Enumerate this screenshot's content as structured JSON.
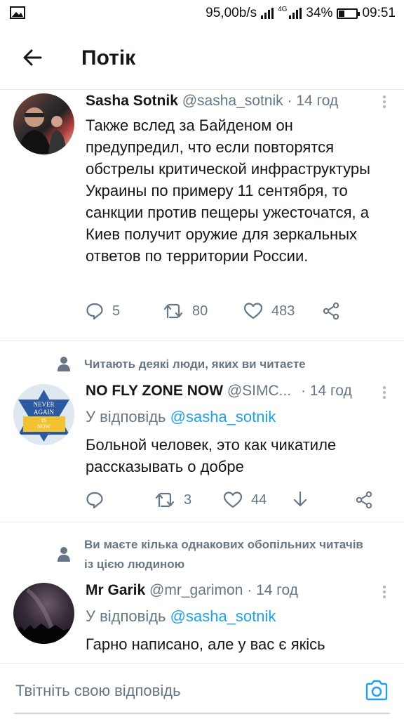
{
  "status_bar": {
    "speed": "95,00b/s",
    "network": "4G",
    "battery": "34%",
    "battery_level": 0.34,
    "time": "09:51"
  },
  "header": {
    "title": "Потік"
  },
  "tweets": [
    {
      "name": "Sasha Sotnik",
      "handle": "@sasha_sotnik",
      "time": "· 14 год",
      "text": "Также вслед за Байденом он предупредил, что если повторятся обстрелы критической инфраструктуры Украины по примеру 11 сентября, то санкции против пещеры ужесточатся, а Киев получит оружие для зеркальных ответов по территории России.",
      "replies": "5",
      "retweets": "80",
      "likes": "483"
    },
    {
      "social_context": "Читають деякі люди, яких ви читаєте",
      "name": "NO FLY ZONE NOW",
      "handle": "@SIMC...",
      "time": "· 14 год",
      "reply_prefix": "У відповідь",
      "reply_handle": "@sasha_sotnik",
      "text": "Больной человек, это как чикатиле рассказывать о добре",
      "avatar_text": "NEVER AGAIN IS NOW",
      "retweets": "3",
      "likes": "44"
    },
    {
      "social_context": "Ви маєте кілька однакових обопільних читачів із цією людиною",
      "name": "Mr Garik",
      "handle": "@mr_garimon",
      "time": "· 14 год",
      "reply_prefix": "У відповідь",
      "reply_handle": "@sasha_sotnik",
      "text": "Гарно написано, але у вас є якісь"
    }
  ],
  "compose": {
    "placeholder": "Твітніть свою відповідь"
  },
  "colors": {
    "accent": "#1da1f2",
    "muted": "#657786",
    "text": "#14171a",
    "divider": "#e6ecf0"
  },
  "icons": [
    "gallery-icon",
    "signal-icon",
    "battery-icon",
    "back-arrow-icon",
    "more-icon",
    "reply-icon",
    "retweet-icon",
    "like-icon",
    "share-icon",
    "download-icon",
    "person-icon",
    "camera-icon"
  ]
}
